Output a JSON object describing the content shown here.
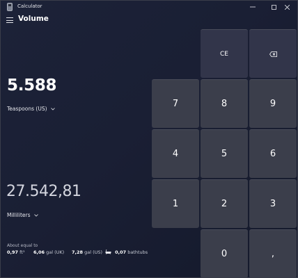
{
  "window": {
    "title": "Calculator",
    "controls": {
      "minimize": "minimize-icon",
      "maximize": "maximize-icon",
      "close": "close-icon"
    }
  },
  "header": {
    "menu_icon": "hamburger-icon",
    "mode": "Volume"
  },
  "converter": {
    "from_value": "5.588",
    "from_unit": "Teaspoons (US)",
    "to_value": "27.542,81",
    "to_unit": "Milliliters"
  },
  "about": {
    "label": "About equal to",
    "items": [
      {
        "value": "0,97",
        "unit": "ft³"
      },
      {
        "value": "6,06",
        "unit": "gal (UK)"
      },
      {
        "value": "7,28",
        "unit": "gal (US)"
      },
      {
        "value": "0,07",
        "unit": "bathtubs",
        "icon": "bathtub-icon"
      }
    ]
  },
  "keypad": {
    "ce": "CE",
    "backspace_icon": "backspace-icon",
    "k7": "7",
    "k8": "8",
    "k9": "9",
    "k4": "4",
    "k5": "5",
    "k6": "6",
    "k1": "1",
    "k2": "2",
    "k3": "3",
    "k0": "0",
    "decimal": ","
  },
  "colors": {
    "background": "#1a1f34",
    "key": "#3b3e4b",
    "text": "#ffffff"
  }
}
